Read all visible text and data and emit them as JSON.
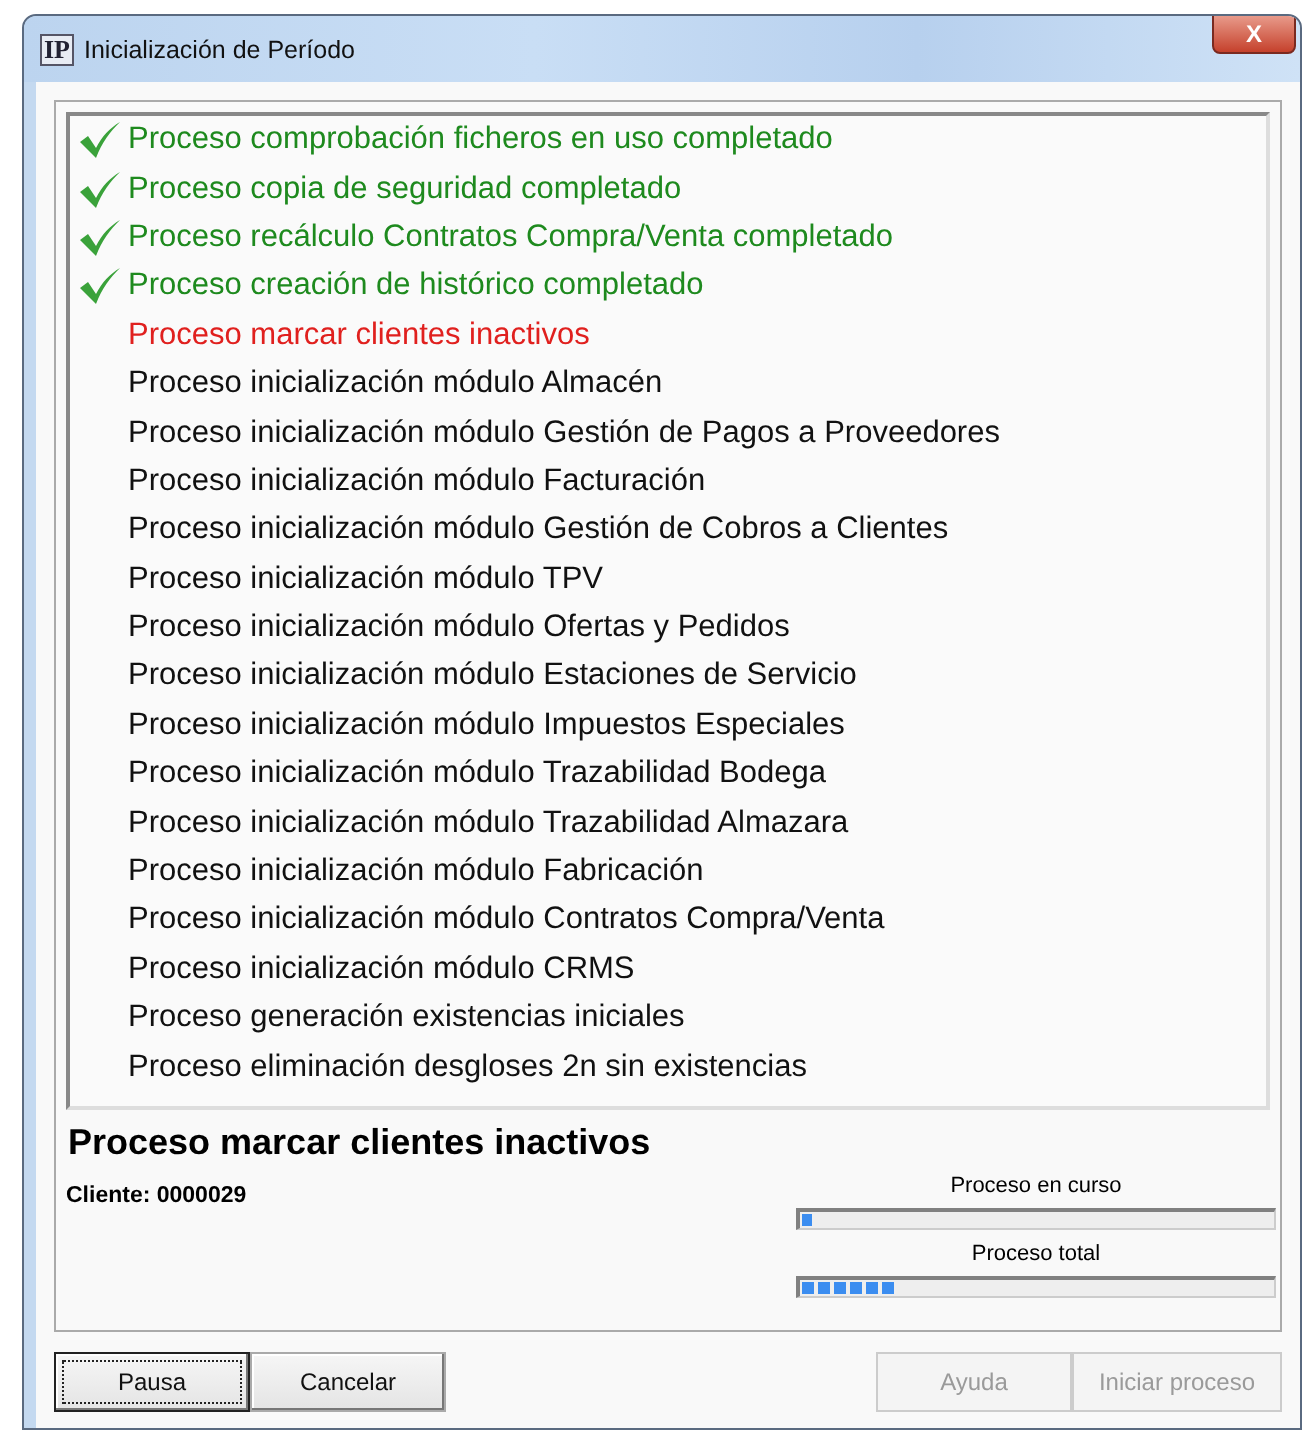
{
  "window": {
    "title": "Inicialización de Período",
    "app_icon_text": "IP",
    "close_label": "X"
  },
  "processes": [
    {
      "label": "Proceso comprobación ficheros en uso completado",
      "kind": "done"
    },
    {
      "label": "Proceso copia de seguridad completado",
      "kind": "done"
    },
    {
      "label": "Proceso recálculo Contratos Compra/Venta completado",
      "kind": "done"
    },
    {
      "label": "Proceso creación de histórico completado",
      "kind": "done"
    },
    {
      "label": "Proceso marcar clientes inactivos",
      "kind": "current"
    },
    {
      "label": "Proceso inicialización módulo Almacén",
      "kind": "pending"
    },
    {
      "label": "Proceso inicialización módulo Gestión de Pagos a Proveedores",
      "kind": "pending"
    },
    {
      "label": "Proceso inicialización módulo Facturación",
      "kind": "pending"
    },
    {
      "label": "Proceso inicialización módulo Gestión de Cobros a Clientes",
      "kind": "pending"
    },
    {
      "label": "Proceso inicialización módulo TPV",
      "kind": "pending"
    },
    {
      "label": "Proceso inicialización módulo Ofertas y Pedidos",
      "kind": "pending"
    },
    {
      "label": "Proceso inicialización módulo Estaciones de Servicio",
      "kind": "pending"
    },
    {
      "label": "Proceso inicialización módulo Impuestos Especiales",
      "kind": "pending"
    },
    {
      "label": "Proceso inicialización módulo Trazabilidad Bodega",
      "kind": "pending"
    },
    {
      "label": "Proceso inicialización módulo Trazabilidad Almazara",
      "kind": "pending"
    },
    {
      "label": "Proceso inicialización módulo Fabricación",
      "kind": "pending"
    },
    {
      "label": "Proceso inicialización módulo Contratos Compra/Venta",
      "kind": "pending"
    },
    {
      "label": "Proceso inicialización módulo CRMS",
      "kind": "pending"
    },
    {
      "label": "Proceso generación existencias iniciales",
      "kind": "pending"
    },
    {
      "label": "Proceso eliminación desgloses 2n sin existencias",
      "kind": "pending"
    }
  ],
  "current": {
    "title": "Proceso marcar clientes inactivos",
    "detail": "Cliente: 0000029"
  },
  "progress": [
    {
      "label": "Proceso en curso",
      "level": 0.02
    },
    {
      "label": "Proceso total",
      "level": 0.2
    }
  ],
  "buttons": [
    {
      "label": "Pausa",
      "disabled": false,
      "focused": true
    },
    {
      "label": "Cancelar",
      "disabled": false,
      "focused": false
    },
    {
      "label": "Ayuda",
      "disabled": true,
      "focused": false
    },
    {
      "label": "Iniciar proceso",
      "disabled": true,
      "focused": false
    }
  ]
}
